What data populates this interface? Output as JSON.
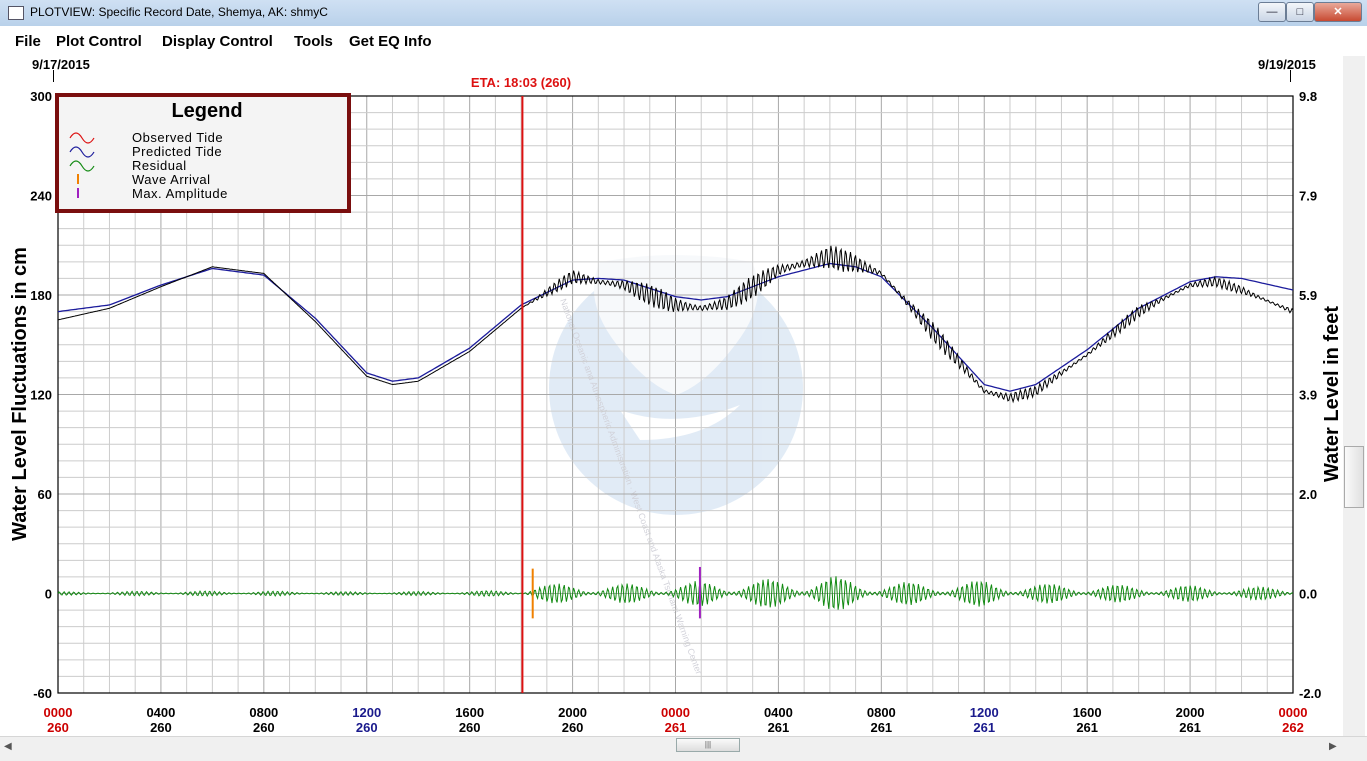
{
  "window": {
    "title": "PLOTVIEW: Specific Record Date, Shemya, AK: shmyC",
    "minimize": "—",
    "maximize": "□",
    "close": "✕"
  },
  "menu": [
    "File",
    "Plot Control",
    "Display Control",
    "Tools",
    "Get EQ Info"
  ],
  "dates": {
    "left": "9/17/2015",
    "right": "9/19/2015"
  },
  "eta_label": "ETA: 18:03 (260)",
  "watermark_text": "National Oceanic and Atmospheric Administration · West Coast and Alaska Tsunami Warning Center",
  "colors": {
    "observed": "#000000",
    "predicted": "#1c1c9c",
    "residual": "#128a12",
    "eta_line": "#dd1111",
    "wave_arrival": "#f08000",
    "max_amplitude": "#a020c0",
    "legend_border": "#7a0e0e",
    "red_time": "#cc0000",
    "blue_time": "#1a1a8c"
  },
  "chart_data": {
    "type": "line",
    "title": "",
    "ylabel": "Water Level Fluctuations in cm",
    "ylabel_right": "Water Level in feet",
    "ylim": [
      -60,
      300
    ],
    "ylim_right": [
      -2.0,
      9.8
    ],
    "yticks_left": [
      "300",
      "240",
      "180",
      "120",
      "60",
      "0",
      "-60"
    ],
    "yticks_right": [
      "9.8",
      "7.9",
      "5.9",
      "3.9",
      "2.0",
      "0.0",
      "-2.0"
    ],
    "x_unit": "hours from 0000 day 260",
    "xlim": [
      0,
      48
    ],
    "xticks": [
      {
        "time": "0000",
        "day": "260",
        "style": "red"
      },
      {
        "time": "0400",
        "day": "260",
        "style": "black"
      },
      {
        "time": "0800",
        "day": "260",
        "style": "black"
      },
      {
        "time": "1200",
        "day": "260",
        "style": "blue"
      },
      {
        "time": "1600",
        "day": "260",
        "style": "black"
      },
      {
        "time": "2000",
        "day": "260",
        "style": "black"
      },
      {
        "time": "0000",
        "day": "261",
        "style": "red"
      },
      {
        "time": "0400",
        "day": "261",
        "style": "black"
      },
      {
        "time": "0800",
        "day": "261",
        "style": "black"
      },
      {
        "time": "1200",
        "day": "261",
        "style": "blue"
      },
      {
        "time": "1600",
        "day": "261",
        "style": "black"
      },
      {
        "time": "2000",
        "day": "261",
        "style": "black"
      },
      {
        "time": "0000",
        "day": "262",
        "style": "red"
      }
    ],
    "legend": {
      "title": "Legend",
      "entries": [
        "Observed Tide",
        "Predicted Tide",
        "Residual",
        "Wave Arrival",
        "Max. Amplitude"
      ]
    },
    "grid": true,
    "eta_hour": 18.05,
    "wave_arrival_hour": 18.45,
    "max_amplitude_hour": 24.95,
    "series": [
      {
        "name": "Predicted Tide",
        "x": [
          0,
          2,
          4,
          6,
          8,
          10,
          12,
          13,
          14,
          16,
          18,
          20,
          21,
          22,
          24,
          25,
          26,
          28,
          30,
          31,
          32,
          34,
          36,
          37,
          38,
          40,
          42,
          44,
          45,
          46,
          48
        ],
        "y": [
          170,
          174,
          186,
          196,
          192,
          166,
          133,
          128,
          130,
          148,
          174,
          189,
          190,
          189,
          179,
          177,
          179,
          191,
          199,
          197,
          191,
          160,
          126,
          122,
          126,
          147,
          172,
          188,
          191,
          190,
          183
        ]
      },
      {
        "name": "Observed Tide",
        "x": [
          0,
          2,
          4,
          6,
          8,
          10,
          12,
          13,
          14,
          16,
          18,
          20,
          21,
          22,
          24,
          25,
          26,
          28,
          30,
          31,
          32,
          34,
          36,
          37,
          38,
          40,
          42,
          44,
          45,
          46,
          48
        ],
        "y": [
          165,
          172,
          185,
          197,
          193,
          164,
          131,
          126,
          128,
          146,
          172,
          191,
          188,
          186,
          174,
          172,
          175,
          195,
          203,
          199,
          193,
          158,
          122,
          118,
          122,
          144,
          170,
          186,
          188,
          183,
          170
        ],
        "noise_amplitude_cm": [
          0,
          0,
          0,
          0,
          0,
          0,
          0,
          0,
          0,
          0,
          0,
          5,
          6,
          6,
          7,
          7,
          6,
          8,
          8,
          6,
          4,
          6,
          5,
          4,
          3,
          3,
          4,
          3,
          3,
          3,
          3
        ]
      },
      {
        "name": "Residual",
        "x": [
          0,
          4,
          8,
          12,
          16,
          18,
          18.45,
          20,
          22,
          24,
          25,
          26,
          28,
          30,
          32,
          34,
          36,
          38,
          40,
          42,
          44,
          46,
          48
        ],
        "amplitude_cm": [
          1,
          1.5,
          1.5,
          1,
          1.5,
          2,
          6,
          6,
          6,
          6,
          8,
          8,
          9,
          11,
          7,
          7,
          8,
          6,
          6,
          5,
          5,
          4,
          4
        ]
      }
    ]
  }
}
